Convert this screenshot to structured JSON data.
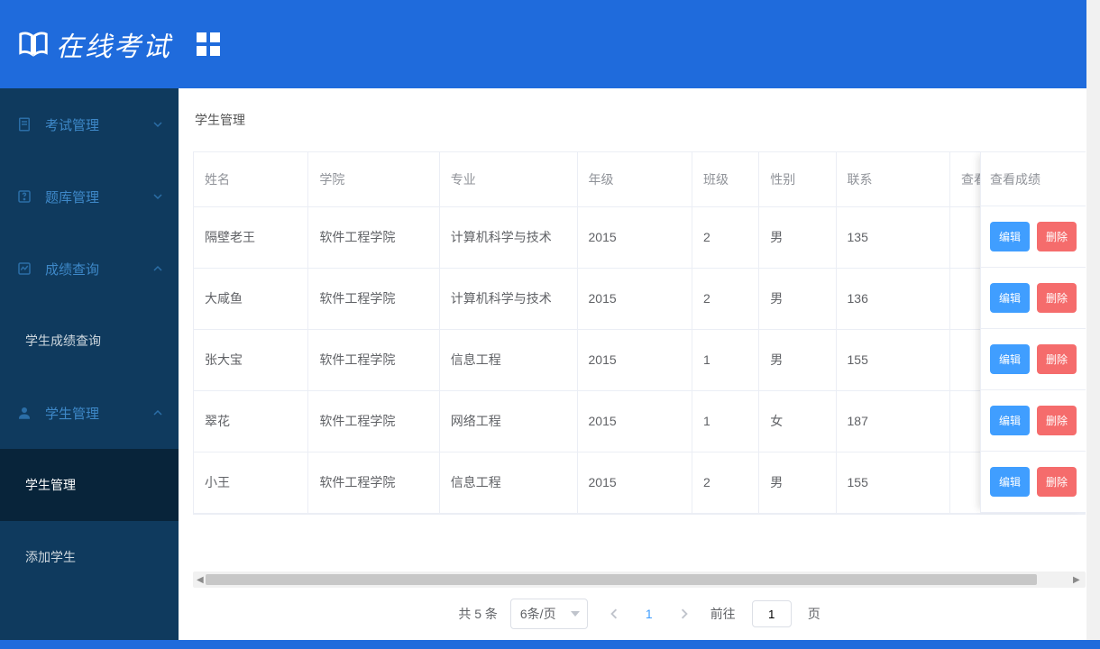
{
  "header": {
    "app_title": "在线考试"
  },
  "sidebar": {
    "items": [
      {
        "label": "考试管理",
        "icon": "exam-icon",
        "expanded": false
      },
      {
        "label": "题库管理",
        "icon": "question-bank-icon",
        "expanded": false
      },
      {
        "label": "成绩查询",
        "icon": "grades-icon",
        "expanded": true,
        "children": [
          {
            "label": "学生成绩查询",
            "active": false
          }
        ]
      },
      {
        "label": "学生管理",
        "icon": "student-icon",
        "expanded": true,
        "children": [
          {
            "label": "学生管理",
            "active": true
          },
          {
            "label": "添加学生",
            "active": false
          }
        ]
      }
    ]
  },
  "breadcrumb": {
    "title": "学生管理"
  },
  "table": {
    "columns": [
      "姓名",
      "学院",
      "专业",
      "年级",
      "班级",
      "性别",
      "联系",
      "查看成绩"
    ],
    "rows": [
      {
        "name": "隔壁老王",
        "college": "软件工程学院",
        "major": "计算机科学与技术",
        "year": "2015",
        "class": "2",
        "gender": "男",
        "phone": "135"
      },
      {
        "name": "大咸鱼",
        "college": "软件工程学院",
        "major": "计算机科学与技术",
        "year": "2015",
        "class": "2",
        "gender": "男",
        "phone": "136"
      },
      {
        "name": "张大宝",
        "college": "软件工程学院",
        "major": "信息工程",
        "year": "2015",
        "class": "1",
        "gender": "男",
        "phone": "155"
      },
      {
        "name": "翠花",
        "college": "软件工程学院",
        "major": "网络工程",
        "year": "2015",
        "class": "1",
        "gender": "女",
        "phone": "187"
      },
      {
        "name": "小王",
        "college": "软件工程学院",
        "major": "信息工程",
        "year": "2015",
        "class": "2",
        "gender": "男",
        "phone": "155"
      }
    ],
    "action_header": "查看成绩",
    "edit_label": "编辑",
    "delete_label": "删除"
  },
  "pager": {
    "total_text": "共 5 条",
    "page_size_label": "6条/页",
    "current_page": "1",
    "jump_prefix": "前往",
    "jump_input_value": "1",
    "jump_suffix": "页"
  }
}
